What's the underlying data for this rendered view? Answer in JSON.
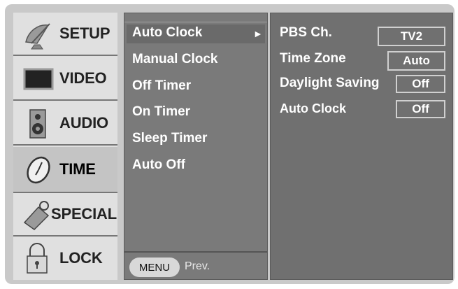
{
  "sidebar": {
    "items": [
      {
        "label": "SETUP",
        "icon": "satellite-dish-icon"
      },
      {
        "label": "VIDEO",
        "icon": "monitor-icon"
      },
      {
        "label": "AUDIO",
        "icon": "speaker-icon"
      },
      {
        "label": "TIME",
        "icon": "clock-icon",
        "active": true
      },
      {
        "label": "SPECIAL",
        "icon": "tag-icon"
      },
      {
        "label": "LOCK",
        "icon": "padlock-icon"
      }
    ]
  },
  "menu": {
    "items": [
      "Auto Clock",
      "Manual Clock",
      "Off Timer",
      "On Timer",
      "Sleep Timer",
      "Auto Off"
    ],
    "arrow": "►"
  },
  "options": [
    {
      "label": "PBS Ch.",
      "value": "TV2"
    },
    {
      "label": "Time Zone",
      "value": "Auto"
    },
    {
      "label": "Daylight Saving",
      "value": "Off"
    },
    {
      "label": "Auto Clock",
      "value": "Off"
    }
  ],
  "footer": {
    "menu_button": "MENU",
    "prev_label": "Prev."
  },
  "colors": {
    "frame": "#c9c9c9",
    "sidebar": "#e0e0e0",
    "middle_panel": "#7a7a7a",
    "right_panel": "#707070",
    "text": "#ffffff"
  }
}
